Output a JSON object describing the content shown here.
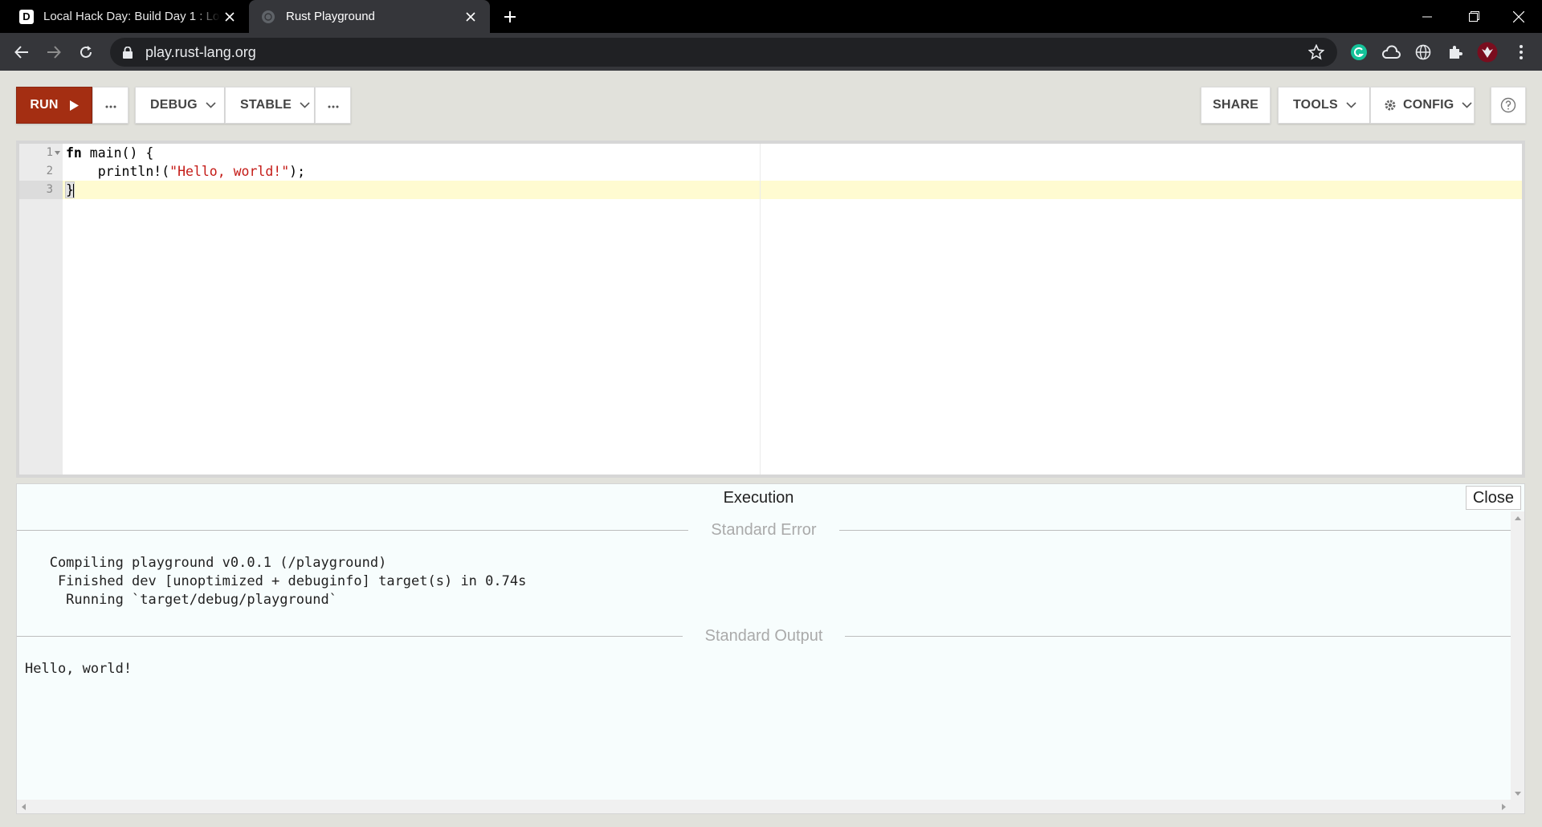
{
  "browser": {
    "tabs": [
      {
        "favicon_letter": "D",
        "title": "Local Hack Day: Build Day 1 : Loc"
      },
      {
        "title": "Rust Playground"
      }
    ],
    "url": "play.rust-lang.org"
  },
  "header": {
    "run_label": "RUN",
    "build_mode": "DEBUG",
    "channel": "STABLE",
    "share_label": "SHARE",
    "tools_label": "TOOLS",
    "config_label": "CONFIG"
  },
  "editor": {
    "lines": [
      {
        "num": "1",
        "parts": [
          {
            "t": "fn",
            "c": "kw"
          },
          {
            "t": " main() {",
            "c": ""
          }
        ]
      },
      {
        "num": "2",
        "parts": [
          {
            "t": "    println!(",
            "c": ""
          },
          {
            "t": "\"Hello, world!\"",
            "c": "str"
          },
          {
            "t": ");",
            "c": ""
          }
        ]
      },
      {
        "num": "3",
        "parts": [
          {
            "t": "}",
            "c": ""
          }
        ]
      }
    ]
  },
  "output": {
    "title": "Execution",
    "close_label": "Close",
    "stderr_title": "Standard Error",
    "stderr_lines": [
      "   Compiling playground v0.0.1 (/playground)",
      "    Finished dev [unoptimized + debuginfo] target(s) in 0.74s",
      "     Running `target/debug/playground`"
    ],
    "stdout_title": "Standard Output",
    "stdout_lines": [
      "Hello, world!"
    ]
  },
  "colors": {
    "run_button": "#a42e12",
    "chrome_dark": "#35363a",
    "page_bg": "#e1e1db",
    "output_bg": "#f7fdfd",
    "string_literal": "#c41a16"
  }
}
